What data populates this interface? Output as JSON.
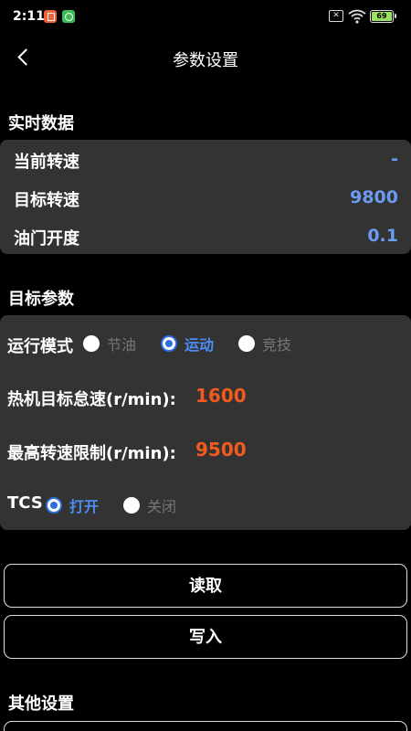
{
  "status_bar": {
    "time": "2:11",
    "battery": "69",
    "sim_icon": "x-box-icon",
    "wifi_icon": "wifi-icon"
  },
  "header": {
    "title": "参数设置",
    "back_icon": "chevron-left-icon"
  },
  "realtime": {
    "title": "实时数据",
    "rows": [
      {
        "label": "当前转速",
        "value": "-"
      },
      {
        "label": "目标转速",
        "value": "9800"
      },
      {
        "label": "油门开度",
        "value": "0.1"
      }
    ]
  },
  "target_params": {
    "title": "目标参数",
    "run_mode": {
      "label": "运行模式",
      "options": [
        {
          "label": "节油",
          "selected": false
        },
        {
          "label": "运动",
          "selected": true
        },
        {
          "label": "竞技",
          "selected": false
        }
      ]
    },
    "idle_speed": {
      "label": "热机目标怠速(r/min):",
      "value": "1600"
    },
    "max_speed": {
      "label": "最高转速限制(r/min):",
      "value": "9500"
    },
    "tcs": {
      "label": "TCS",
      "options": [
        {
          "label": "打开",
          "selected": true
        },
        {
          "label": "关闭",
          "selected": false
        }
      ]
    }
  },
  "buttons": {
    "read": "读取",
    "write": "写入"
  },
  "other": {
    "title": "其他设置"
  },
  "colors": {
    "accent_blue": "#4d8cf5",
    "value_blue": "#6b9bf2",
    "value_orange": "#f25a1e",
    "card_bg": "#333333"
  }
}
